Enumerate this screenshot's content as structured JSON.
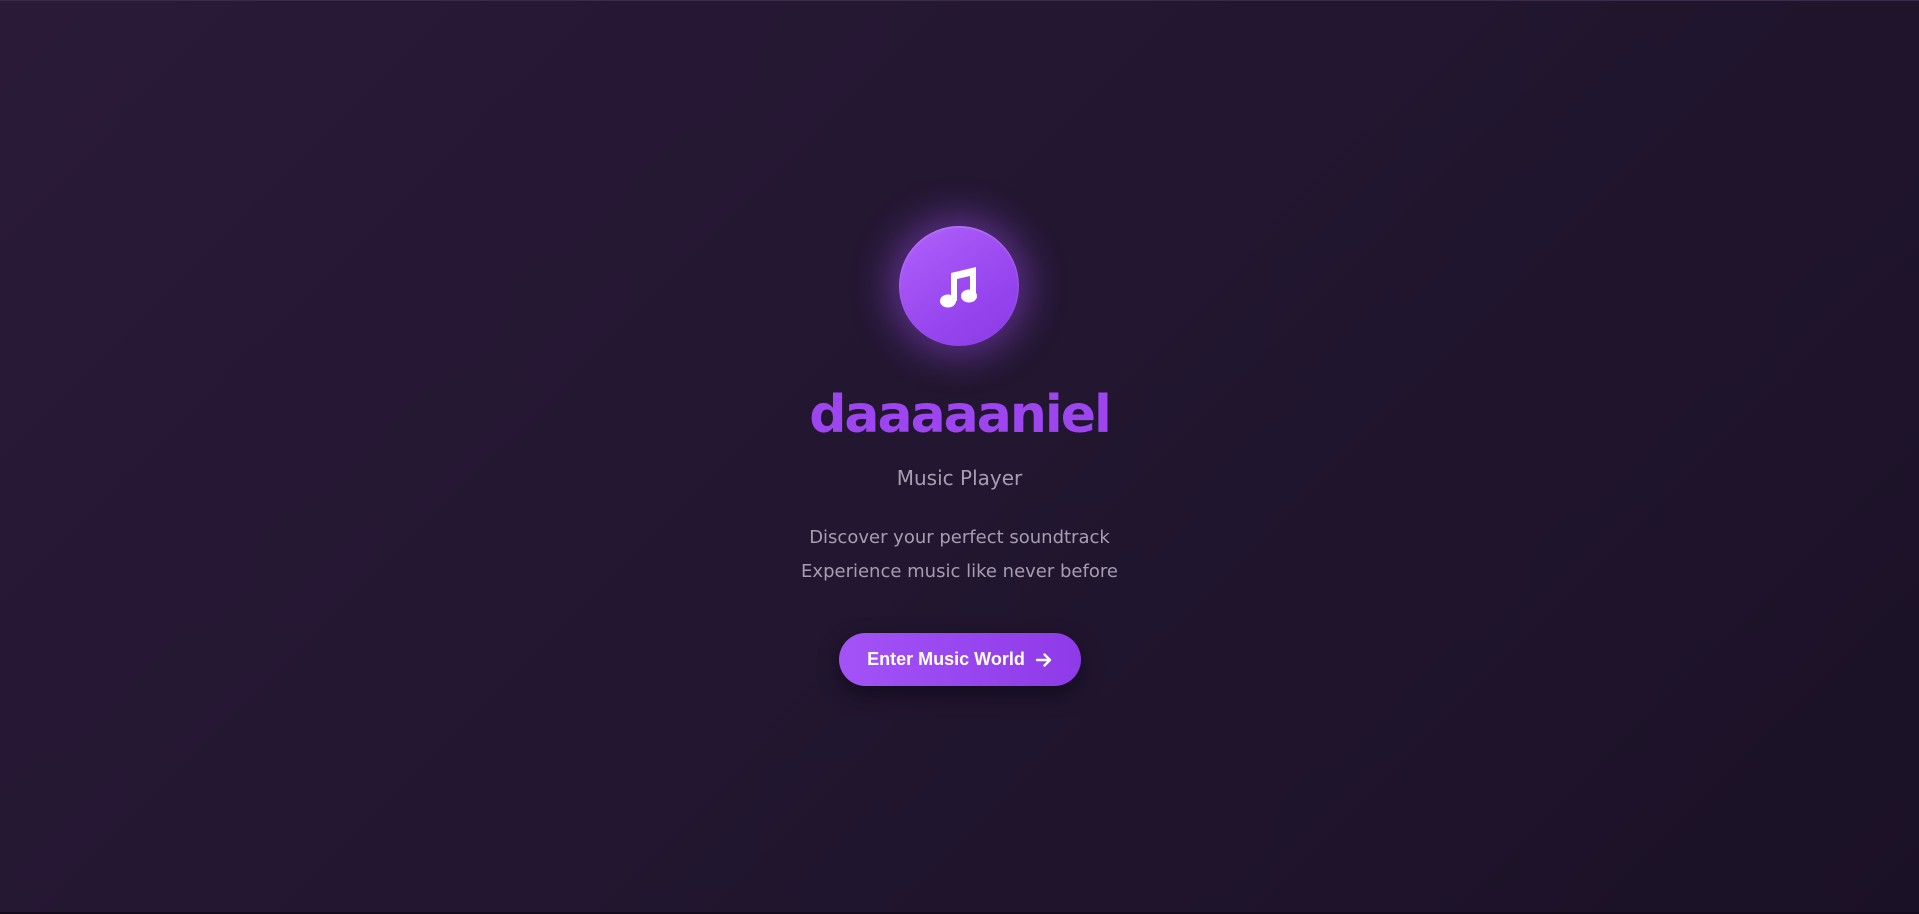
{
  "hero": {
    "logo_icon": "music-note-icon",
    "title": "daaaaaniel",
    "subtitle": "Music Player",
    "taglines": [
      "Discover your perfect soundtrack",
      "Experience music like never before"
    ],
    "cta": {
      "label": "Enter Music World",
      "icon": "arrow-right-icon"
    }
  },
  "colors": {
    "accent": "#9d46f0",
    "accent_light": "#b062fb",
    "background": "#221630",
    "muted_text": "#a79db3",
    "button_text": "#ffffff"
  }
}
